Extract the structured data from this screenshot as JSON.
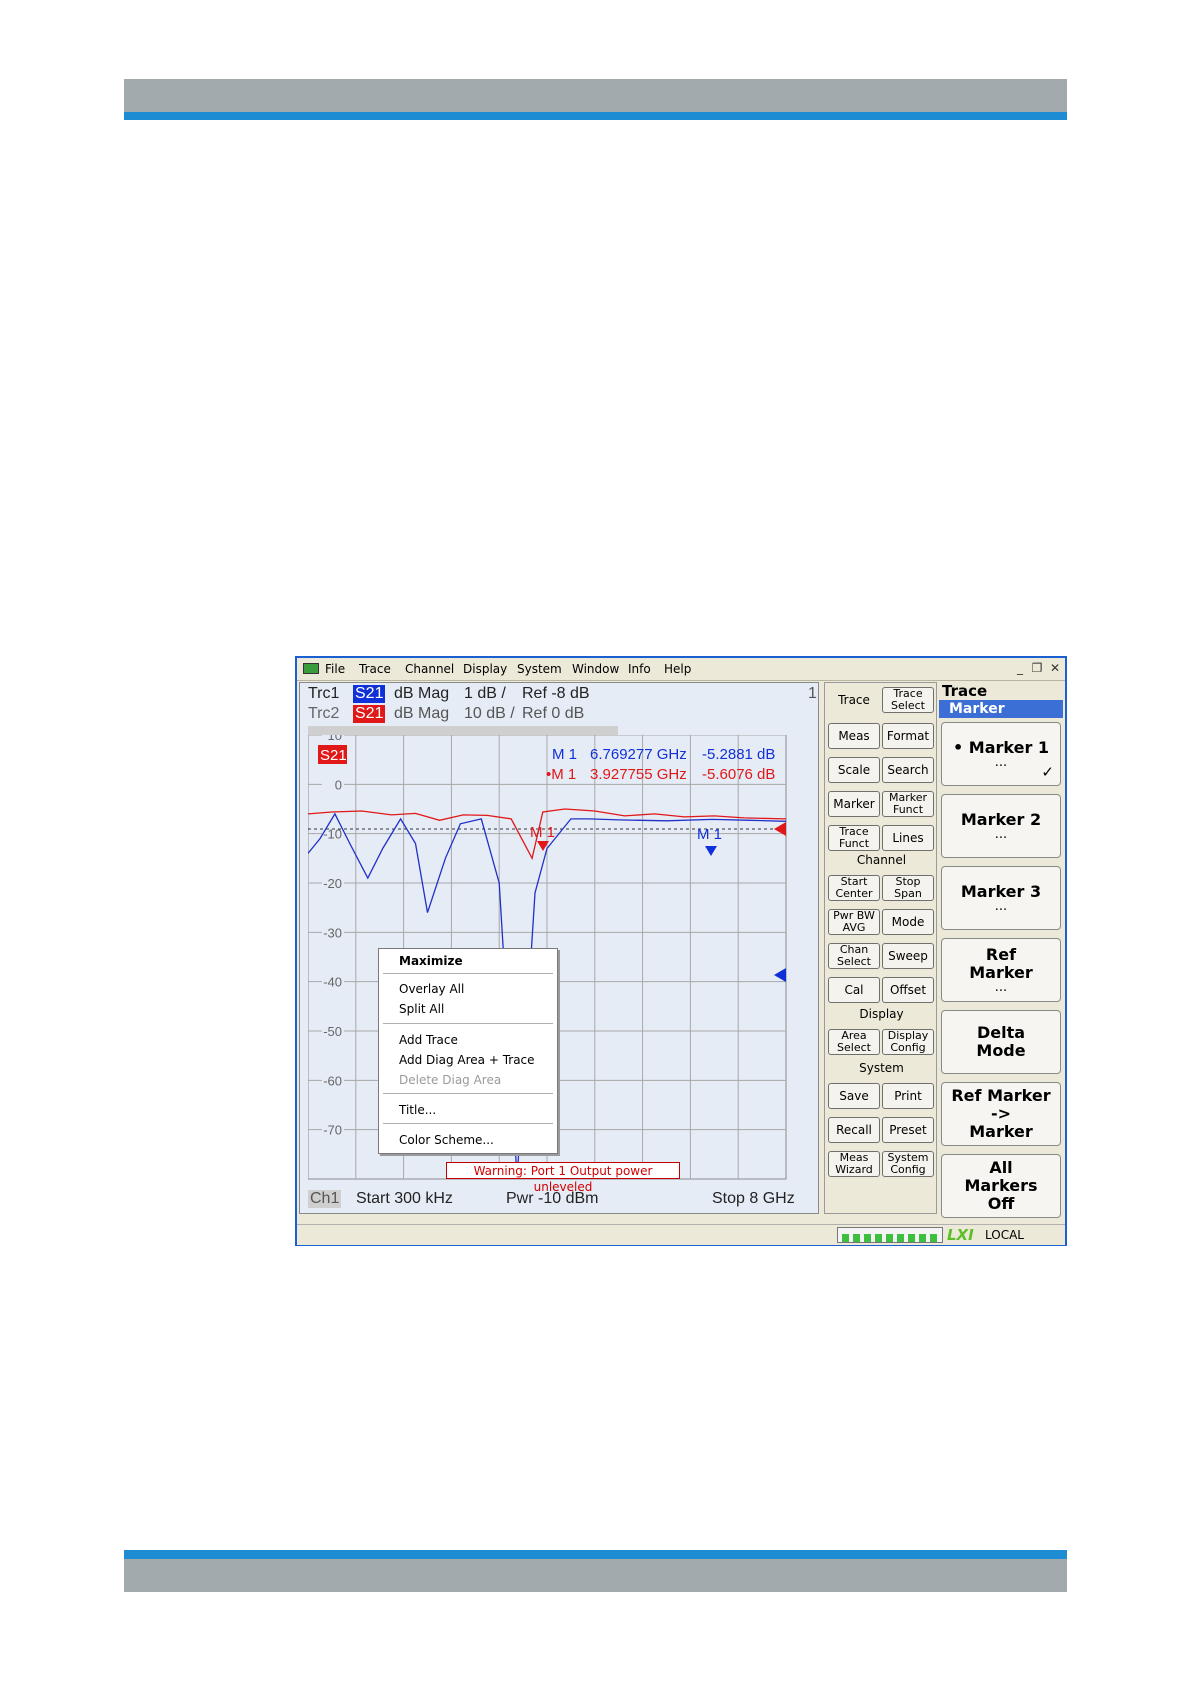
{
  "menubar": {
    "items": [
      "File",
      "Trace",
      "Channel",
      "Display",
      "System",
      "Window",
      "Info",
      "Help"
    ],
    "window_buttons": [
      "_",
      "❐",
      "✕"
    ]
  },
  "trace_header": {
    "trc1": {
      "name": "Trc1",
      "param": "S21",
      "format": "dB Mag",
      "scale": "1 dB /",
      "ref": "Ref -8 dB",
      "color": "#1030d8"
    },
    "trc2": {
      "name": "Trc2",
      "param": "S21",
      "format": "dB Mag",
      "scale": "10 dB /",
      "ref": "Ref 0 dB",
      "color": "#e01818"
    },
    "channel_index": "1"
  },
  "diagram": {
    "badge": "S21",
    "markers": [
      {
        "label": "M 1",
        "freq": "6.769277 GHz",
        "value": "-5.2881 dB",
        "color": "#1030d8"
      },
      {
        "label": "•M 1",
        "freq": "3.927755 GHz",
        "value": "-5.6076 dB",
        "color": "#e01818"
      }
    ],
    "marker_tags": {
      "red": "M 1",
      "blue": "M 1"
    },
    "y_ticks": [
      "10",
      "0",
      "-10",
      "-20",
      "-30",
      "-40",
      "-50",
      "-60",
      "-70"
    ],
    "y_range": [
      -80,
      10
    ],
    "freq_range_ghz": [
      0.0003,
      8
    ],
    "chart_data": {
      "type": "line",
      "series": [
        {
          "color": "#2030c8",
          "points": [
            [
              0,
              -14
            ],
            [
              0.2,
              -11
            ],
            [
              0.45,
              -6
            ],
            [
              0.7,
              -12
            ],
            [
              1.0,
              -19
            ],
            [
              1.25,
              -13
            ],
            [
              1.55,
              -7
            ],
            [
              1.8,
              -12
            ],
            [
              2.0,
              -26
            ],
            [
              2.3,
              -15
            ],
            [
              2.55,
              -8
            ],
            [
              2.9,
              -7
            ],
            [
              3.2,
              -20
            ],
            [
              3.4,
              -60
            ],
            [
              3.5,
              -80
            ],
            [
              3.6,
              -60
            ],
            [
              3.8,
              -22
            ],
            [
              4.0,
              -13
            ],
            [
              4.4,
              -7
            ],
            [
              4.7,
              -7
            ],
            [
              5.2,
              -7.2
            ],
            [
              6.0,
              -7.4
            ],
            [
              6.77,
              -7.1
            ],
            [
              7.4,
              -7.3
            ],
            [
              8.0,
              -7.5
            ]
          ]
        },
        {
          "color": "#e01818",
          "points": [
            [
              0,
              -6
            ],
            [
              0.4,
              -5.6
            ],
            [
              0.9,
              -5.4
            ],
            [
              1.4,
              -6.2
            ],
            [
              1.8,
              -5.9
            ],
            [
              2.2,
              -7.3
            ],
            [
              2.6,
              -6.2
            ],
            [
              3.0,
              -6.3
            ],
            [
              3.4,
              -7.0
            ],
            [
              3.75,
              -15
            ],
            [
              3.93,
              -5.6
            ],
            [
              4.3,
              -5.0
            ],
            [
              4.8,
              -5.4
            ],
            [
              5.3,
              -6.4
            ],
            [
              5.8,
              -6.0
            ],
            [
              6.3,
              -6.6
            ],
            [
              6.8,
              -6.4
            ],
            [
              7.3,
              -6.8
            ],
            [
              8.0,
              -7.0
            ]
          ]
        }
      ]
    },
    "footer": {
      "channel": "Ch1",
      "start": "Start  300 kHz",
      "power": "Pwr  -10 dBm",
      "stop": "Stop  8 GHz"
    },
    "warning": "Warning: Port 1 Output power unleveled"
  },
  "context_menu": {
    "items": [
      {
        "label": "Maximize",
        "bold": true
      },
      {
        "label": "Overlay All"
      },
      {
        "label": "Split All"
      },
      {
        "label": "Add Trace"
      },
      {
        "label": "Add Diag Area + Trace"
      },
      {
        "label": "Delete Diag Area",
        "disabled": true
      },
      {
        "label": "Title..."
      },
      {
        "label": "Color Scheme..."
      }
    ]
  },
  "softkeys": {
    "trace": [
      "Trace",
      "Trace Select",
      "Meas",
      "Format",
      "Scale",
      "Search",
      "Marker",
      "Marker Funct",
      "Trace Funct",
      "Lines"
    ],
    "channel_title": "Channel",
    "channel": [
      "Start Center",
      "Stop Span",
      "Pwr BW AVG",
      "Mode",
      "Chan Select",
      "Sweep",
      "Cal",
      "Offset"
    ],
    "display_title": "Display",
    "display": [
      "Area Select",
      "Display Config"
    ],
    "system_title": "System",
    "system": [
      "Save",
      "Print",
      "Recall",
      "Preset",
      "Meas Wizard",
      "System Config"
    ]
  },
  "right_panel": {
    "trace": "Trace",
    "marker": "Marker",
    "buttons": [
      {
        "line1": "• Marker 1",
        "dots": "...",
        "check": "✓"
      },
      {
        "line1": "Marker 2",
        "dots": "..."
      },
      {
        "line1": "Marker 3",
        "dots": "..."
      },
      {
        "line1": "Ref",
        "line2": "Marker",
        "dots": "..."
      },
      {
        "line1": "Delta",
        "line2": "Mode"
      },
      {
        "line1": "Ref Marker",
        "line2": "->",
        "line3": "Marker"
      },
      {
        "line1": "All",
        "line2": "Markers",
        "line3": "Off"
      }
    ]
  },
  "status": {
    "lxi": "LXI",
    "mode": "LOCAL"
  }
}
